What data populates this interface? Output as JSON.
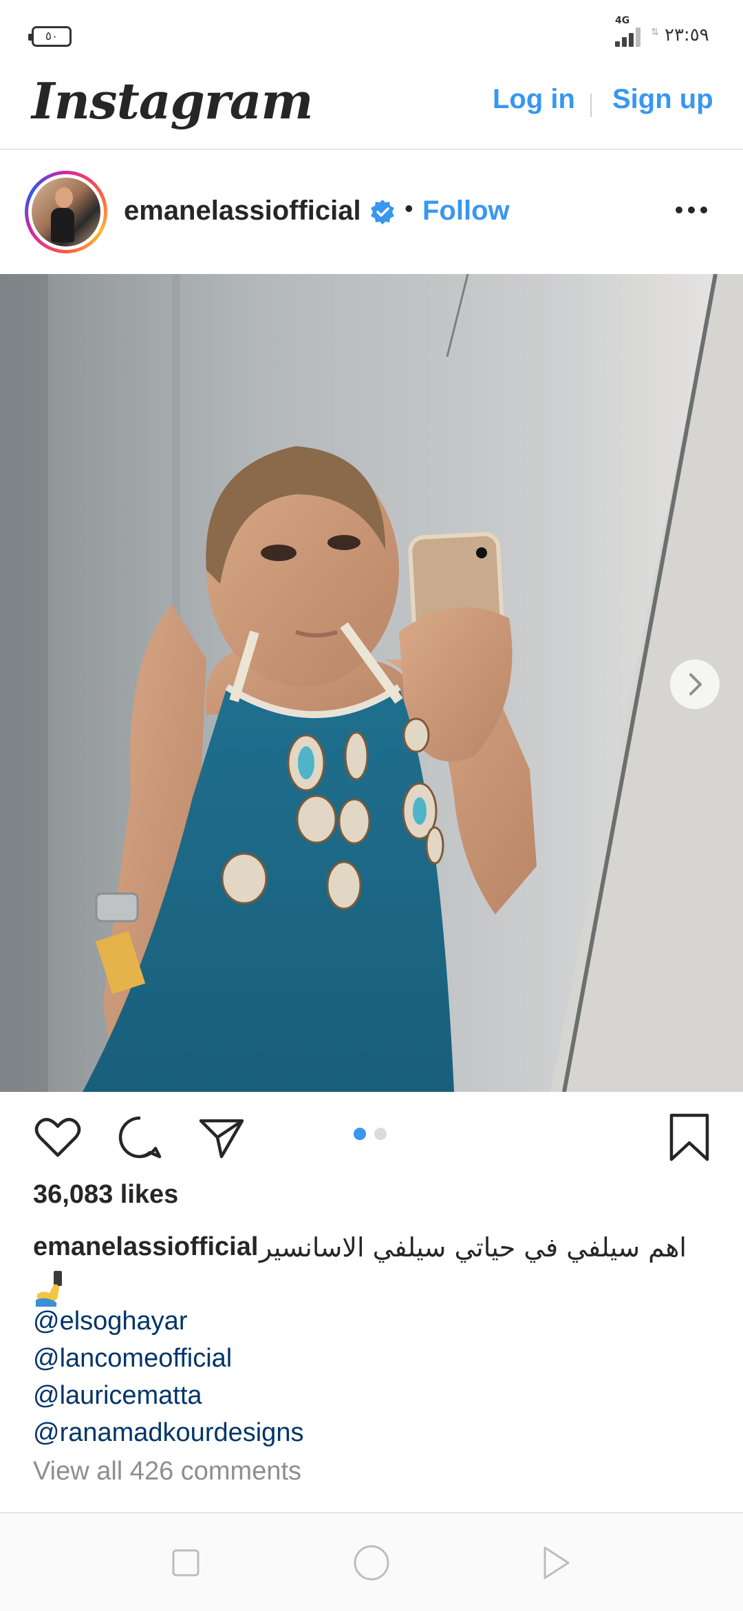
{
  "status_bar": {
    "battery": "٥٠",
    "network": "4G",
    "time": "٢٣:٥٩"
  },
  "header": {
    "logo": "Instagram",
    "login_label": "Log in",
    "signup_label": "Sign up"
  },
  "post": {
    "username": "emanelassiofficial",
    "verified": true,
    "separator": "•",
    "follow_label": "Follow",
    "carousel": {
      "current_index": 1,
      "total": 2
    },
    "likes": "36,083 likes",
    "caption": {
      "username": "emanelassiofficial",
      "text": "اهم سيلفي في حياتي سيلفي الاسانسير",
      "emoji": "selfie-emoji",
      "mentions": [
        "@elsoghayar",
        "@lancomeofficial",
        "@lauricematta",
        "@ranamadkourdesigns"
      ]
    },
    "view_all_comments": "View all 426 comments"
  },
  "colors": {
    "link_blue": "#3897f0",
    "mention_blue": "#003569",
    "text": "#262626",
    "muted": "#8e8e8e"
  },
  "icons": [
    "heart-icon",
    "comment-icon",
    "share-icon",
    "bookmark-icon",
    "more-icon",
    "verified-badge-icon",
    "chevron-right-icon"
  ]
}
